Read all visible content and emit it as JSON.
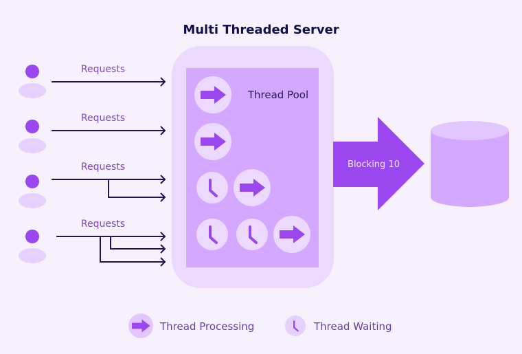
{
  "title": "Multi Threaded Server",
  "clients": [
    {
      "request_label": "Requests",
      "request_count": 1
    },
    {
      "request_label": "Requests",
      "request_count": 1
    },
    {
      "request_label": "Requests",
      "request_count": 2
    },
    {
      "request_label": "Requests",
      "request_count": 3
    }
  ],
  "server": {
    "pool_label": "Thread Pool",
    "threads": [
      {
        "row": 1,
        "state": "processing"
      },
      {
        "row": 2,
        "state": "processing"
      },
      {
        "row": 3,
        "state": "waiting"
      },
      {
        "row": 3,
        "state": "processing"
      },
      {
        "row": 4,
        "state": "waiting"
      },
      {
        "row": 4,
        "state": "waiting"
      },
      {
        "row": 4,
        "state": "processing"
      }
    ]
  },
  "blocking_arrow": {
    "label": "Blocking 10"
  },
  "database": {
    "icon": "database-cylinder-icon"
  },
  "legend": [
    {
      "icon": "arrow-right-icon",
      "label": "Thread Processing"
    },
    {
      "icon": "clock-icon",
      "label": "Thread Waiting"
    }
  ],
  "colors": {
    "background": "#f7f1fe",
    "accent": "#9b47f0",
    "light": "#ecdafe",
    "medium": "#d4a8ff",
    "dark_text": "#12104a",
    "request_text": "#7a48b8"
  }
}
